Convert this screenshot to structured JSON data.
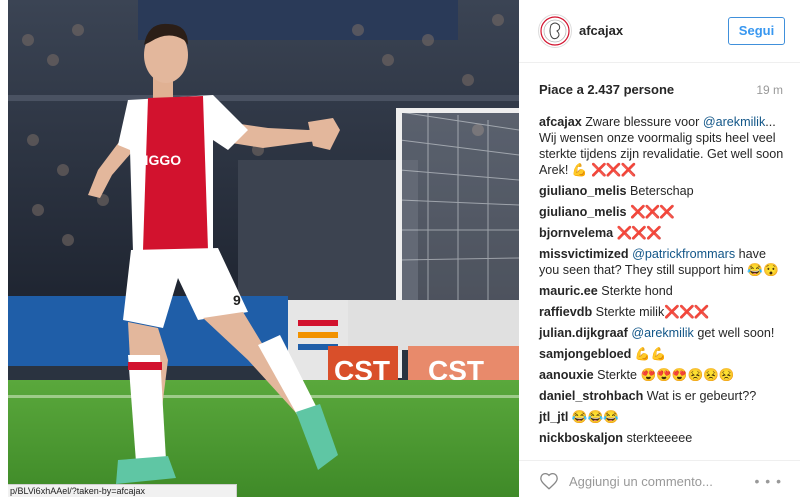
{
  "photo": {
    "url_text": "p/BLVi6xhAAel/?taken-by=afcajax",
    "shirt_sponsor": "ZIGGO",
    "shirt_number": "9",
    "board_texts": [
      "CST",
      "CST"
    ]
  },
  "post": {
    "username": "afcajax",
    "follow_label": "Segui",
    "likes_text": "Piace a 2.437 persone",
    "time_ago": "19 m",
    "caption": {
      "user": "afcajax",
      "text_before": " Zware blessure voor ",
      "mention": "@arekmilik",
      "text_after": "... Wij wensen onze voormalig spits heel veel sterkte tijdens zijn revalidatie. Get well soon Arek! 💪 ",
      "marks": "❌❌❌"
    },
    "comments": [
      {
        "user": "giuliano_melis",
        "text": " Beterschap"
      },
      {
        "user": "giuliano_melis",
        "text": " ",
        "marks": "❌❌❌"
      },
      {
        "user": "bjornvelema",
        "text": " ",
        "marks": "❌❌❌"
      },
      {
        "user": "missvictimized",
        "text": " ",
        "mention": "@patrickfrommars",
        "after": " have you seen that? They still support him 😂😯"
      },
      {
        "user": "mauric.ee",
        "text": " Sterkte hond"
      },
      {
        "user": "raffievdb",
        "text": " Sterkte milik",
        "marks": "❌❌❌"
      },
      {
        "user": "julian.dijkgraaf",
        "text": " ",
        "mention": "@arekmilik",
        "after": " get well soon!"
      },
      {
        "user": "samjongebloed",
        "text": " 💪💪"
      },
      {
        "user": "aanouxie",
        "text": " Sterkte 😍😍😍😣😣😣"
      },
      {
        "user": "daniel_strohbach",
        "text": " Wat is er gebeurt??"
      },
      {
        "user": "jtl_jtl",
        "text": " 😂😂😂"
      },
      {
        "user": "nickboskaljon",
        "text": " sterkteeeee"
      }
    ],
    "add_comment_placeholder": "Aggiungi un commento...",
    "more_label": "• • •"
  },
  "icons": {
    "heart": "heart-icon",
    "logo": "ajax-logo-icon",
    "more": "more-options-icon"
  },
  "colors": {
    "follow_blue": "#3897f0",
    "mention_blue": "#125688",
    "x_red": "#e0243c",
    "ajax_red": "#d2122e"
  }
}
